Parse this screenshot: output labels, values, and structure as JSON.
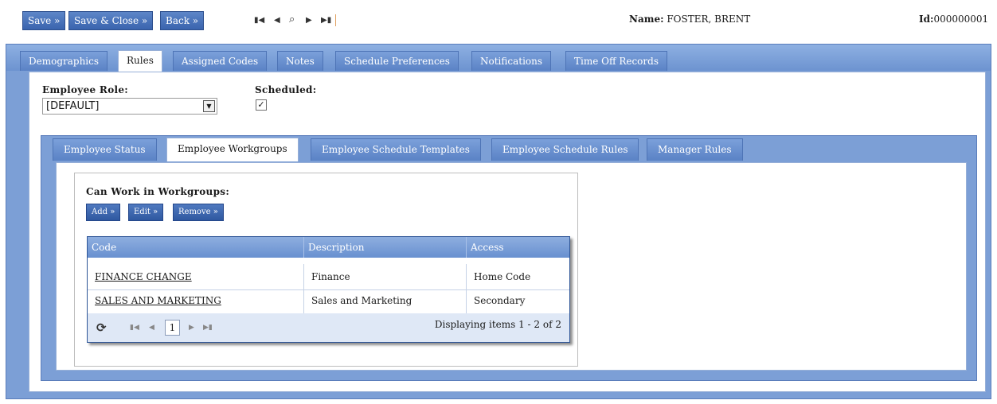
{
  "toolbar": {
    "save": "Save »",
    "save_close": "Save & Close »",
    "back": "Back »"
  },
  "record_nav": {
    "icons": [
      "first-record-icon",
      "prev-record-icon",
      "search-icon",
      "next-record-icon",
      "last-record-icon"
    ]
  },
  "header": {
    "name_label": "Name:",
    "name_value": "FOSTER, BRENT",
    "id_label": "Id:",
    "id_value": "000000001"
  },
  "outer_tabs": [
    "Demographics",
    "Rules",
    "Assigned Codes",
    "Notes",
    "Schedule Preferences",
    "Notifications",
    "Time Off Records"
  ],
  "outer_active": "Rules",
  "rules": {
    "employee_role_label": "Employee Role:",
    "employee_role_value": "[DEFAULT]",
    "scheduled_label": "Scheduled:",
    "scheduled_checked": true
  },
  "inner_tabs": [
    "Employee Status",
    "Employee Workgroups",
    "Employee Schedule Templates",
    "Employee Schedule Rules",
    "Manager Rules"
  ],
  "inner_active": "Employee Workgroups",
  "workgroups": {
    "title": "Can Work in Workgroups:",
    "buttons": {
      "add": "Add »",
      "edit": "Edit »",
      "remove": "Remove »"
    },
    "columns": [
      "Code",
      "Description",
      "Access"
    ],
    "rows": [
      {
        "code": "FINANCE CHANGE",
        "description": "Finance",
        "access": "Home Code"
      },
      {
        "code": "SALES AND MARKETING",
        "description": "Sales and Marketing",
        "access": "Secondary"
      }
    ],
    "pager": {
      "page": "1",
      "status": "Displaying items 1 - 2 of 2"
    }
  },
  "colors": {
    "tab_blue": "#7c9fd6",
    "button_blue": "#3a64ae",
    "grid_header": "#6890d0"
  }
}
